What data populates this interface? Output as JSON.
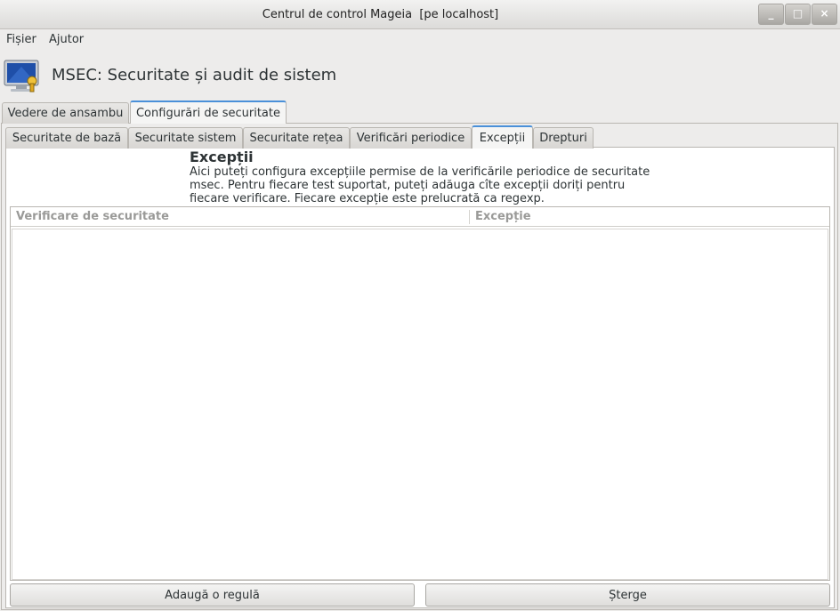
{
  "window": {
    "title": "Centrul de control Mageia  [pe localhost]",
    "controls": {
      "minimize": "_",
      "maximize": "□",
      "close": "×"
    }
  },
  "menubar": [
    "Fișier",
    "Ajutor"
  ],
  "app": {
    "icon": "monitor-security-icon",
    "title": "MSEC: Securitate și audit de sistem"
  },
  "main_tabs": [
    {
      "label": "Vedere de ansambu",
      "active": false
    },
    {
      "label": "Configurări de securitate",
      "active": true
    }
  ],
  "sub_tabs": [
    {
      "label": "Securitate de bază",
      "active": false
    },
    {
      "label": "Securitate sistem",
      "active": false
    },
    {
      "label": "Securitate rețea",
      "active": false
    },
    {
      "label": "Verificări periodice",
      "active": false
    },
    {
      "label": "Excepții",
      "active": true
    },
    {
      "label": "Drepturi",
      "active": false
    }
  ],
  "section": {
    "title": "Excepții",
    "description_lines": [
      "Aici puteți configura excepțiile permise de la verificările periodice de securitate",
      "msec. Pentru fiecare test suportat, puteți adăuga cîte excepții doriți pentru",
      "fiecare verificare. Fiecare excepție este prelucrată ca regexp."
    ]
  },
  "table": {
    "columns": [
      "Verificare de securitate",
      "Excepție"
    ],
    "rows": []
  },
  "buttons": {
    "add": "Adaugă o regulă",
    "delete": "Șterge"
  },
  "colors": {
    "active_tab_accent": "#4a90d9",
    "background": "#edeceb"
  }
}
